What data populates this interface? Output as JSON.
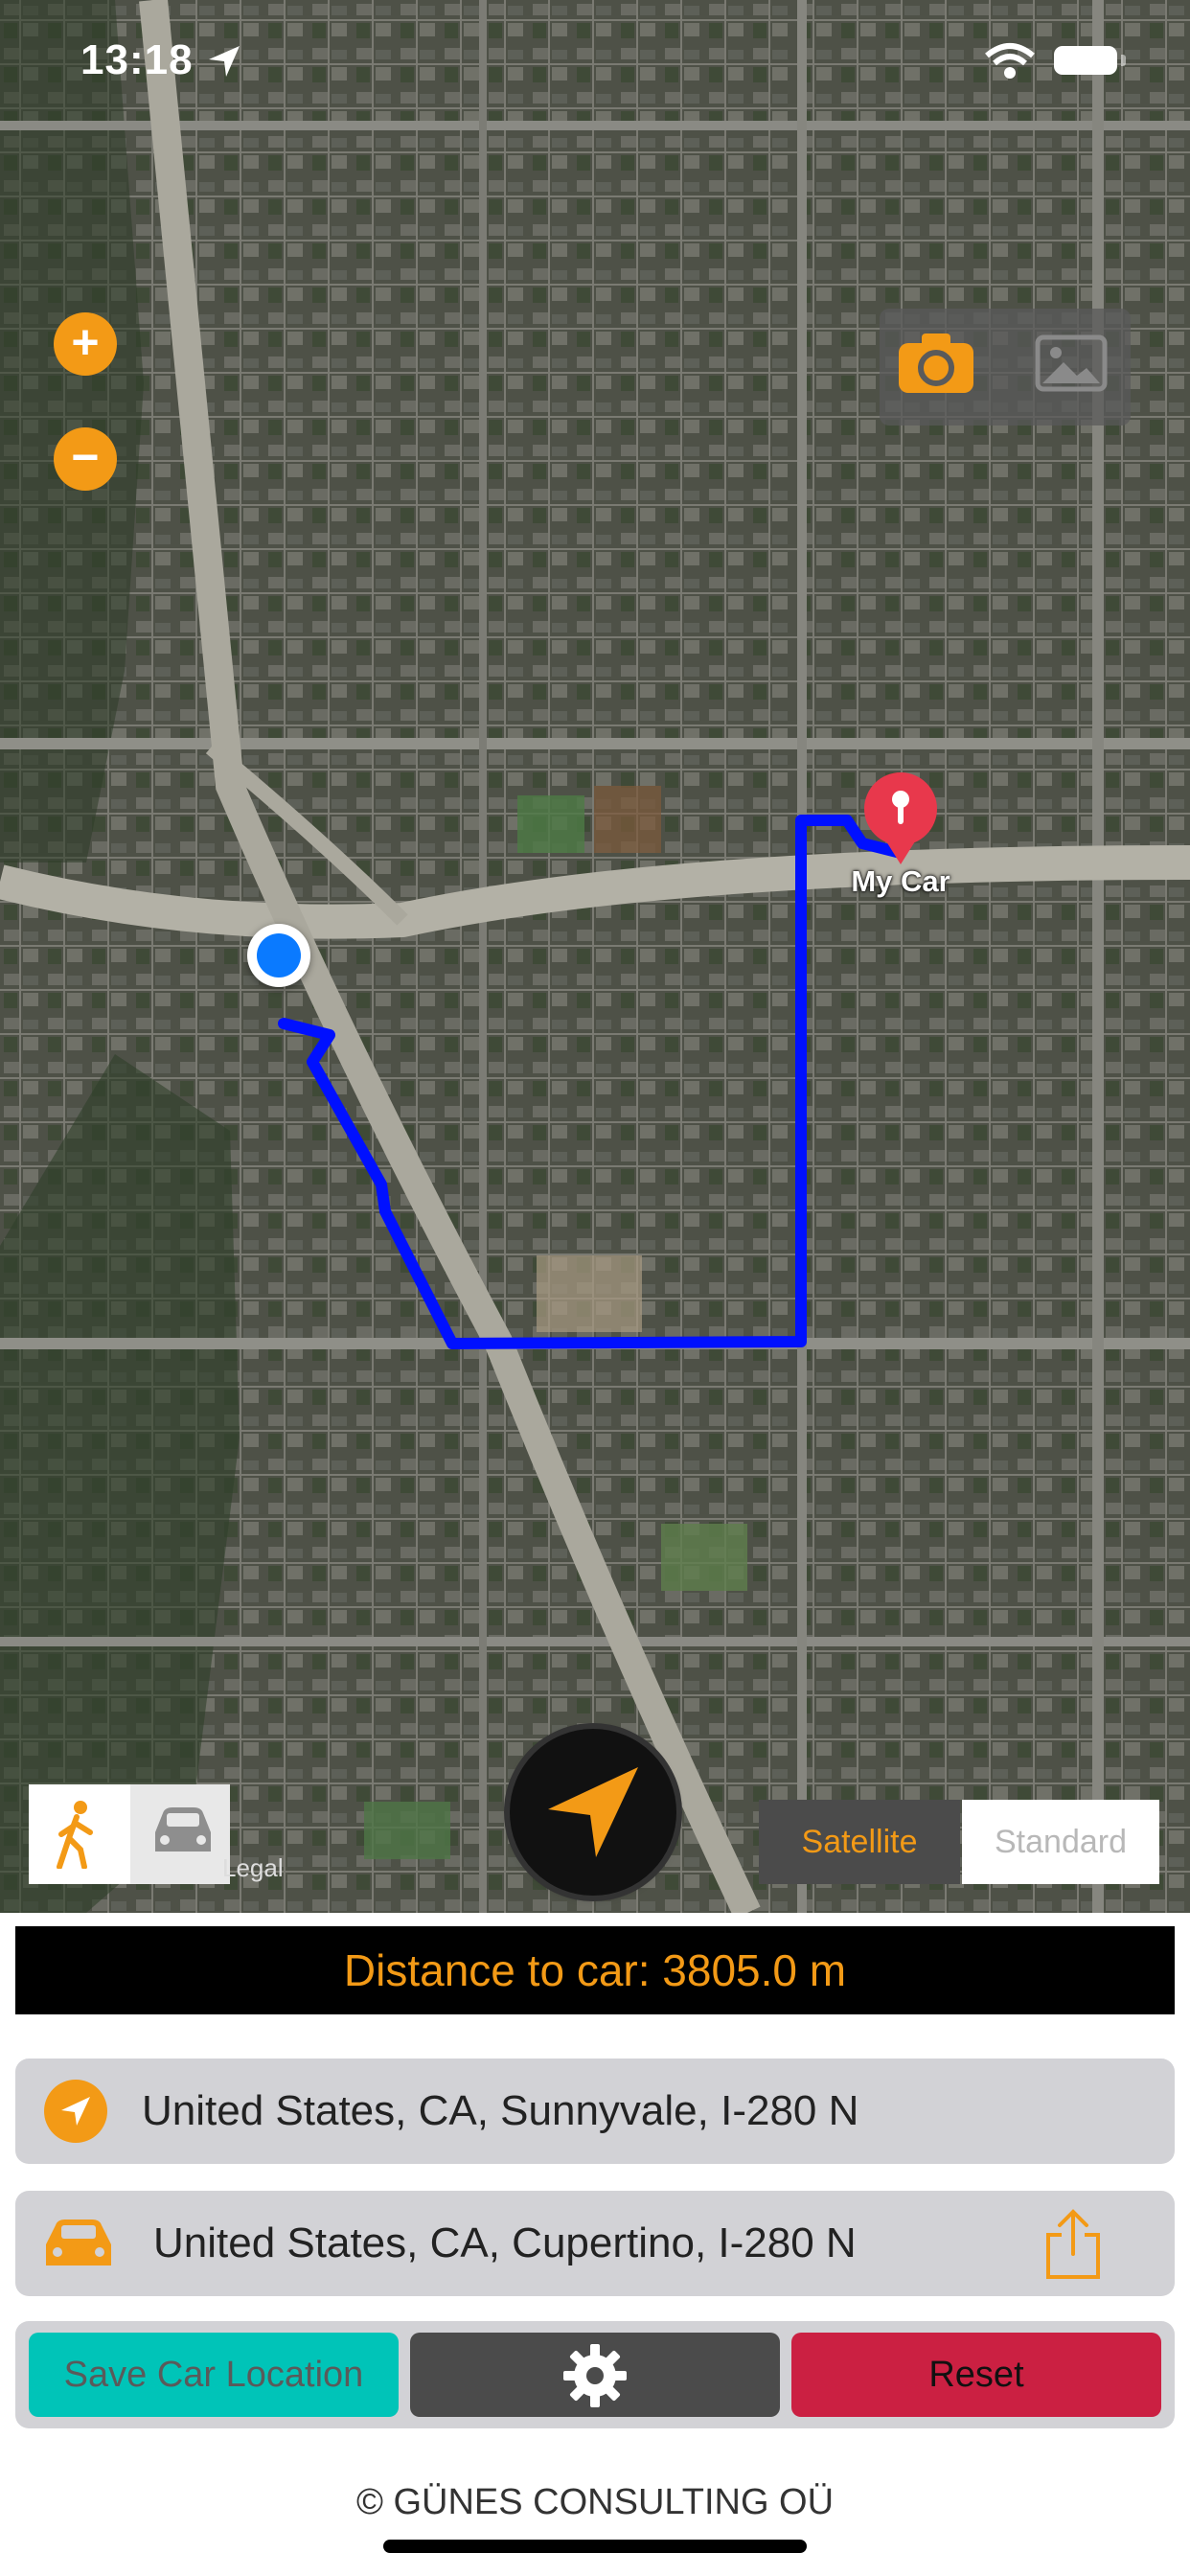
{
  "status": {
    "time": "13:18"
  },
  "map": {
    "zoom_in_label": "+",
    "zoom_out_label": "−",
    "pin_label": "My Car",
    "legal": "Legal",
    "map_type": {
      "satellite": "Satellite",
      "standard": "Standard",
      "selected": "Satellite"
    },
    "travel_mode": {
      "walk": "walking-icon",
      "car": "car-icon",
      "selected": "walk"
    },
    "route_color": "#0010ff"
  },
  "distance": {
    "text": "Distance to car: 3805.0 m"
  },
  "current_location": {
    "address": "United States, CA, Sunnyvale, I-280 N"
  },
  "car_location": {
    "address": "United States, CA, Cupertino, I-280 N"
  },
  "buttons": {
    "save": "Save Car Location",
    "reset": "Reset"
  },
  "footer": {
    "copyright": "© GÜNES CONSULTING OÜ"
  },
  "colors": {
    "accent": "#f39a16",
    "save": "#00c4b8",
    "reset": "#cb2042"
  }
}
